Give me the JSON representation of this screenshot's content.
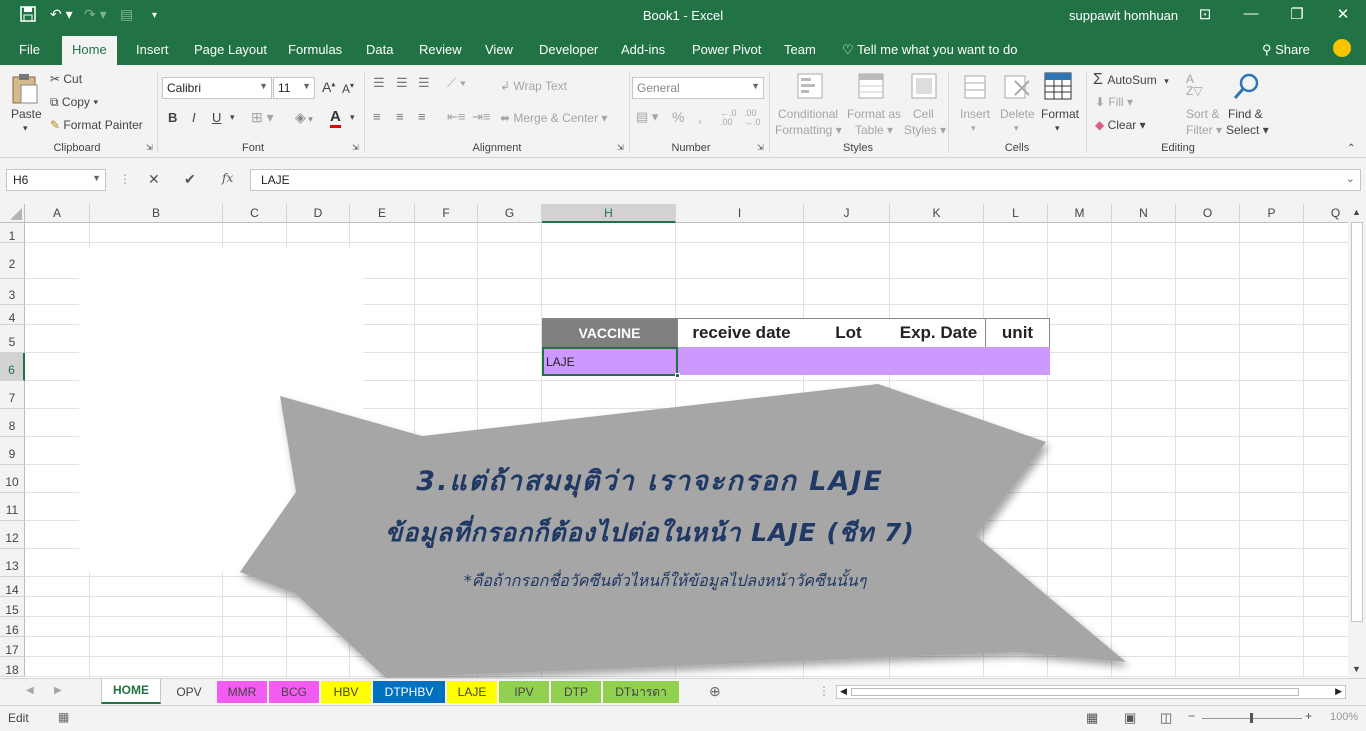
{
  "window": {
    "title": "Book1  -  Excel",
    "user": "suppawit homhuan"
  },
  "menu": {
    "tabs": [
      "File",
      "Home",
      "Insert",
      "Page Layout",
      "Formulas",
      "Data",
      "Review",
      "View",
      "Developer",
      "Add-ins",
      "Power Pivot",
      "Team"
    ],
    "tell_me": "Tell me what you want to do",
    "share": "Share"
  },
  "ribbon": {
    "clipboard": {
      "paste": "Paste",
      "cut": "Cut",
      "copy": "Copy",
      "format_painter": "Format Painter",
      "label": "Clipboard"
    },
    "font": {
      "name": "Calibri",
      "size": "11",
      "bold": "B",
      "italic": "I",
      "underline": "U",
      "label": "Font"
    },
    "alignment": {
      "wrap": "Wrap Text",
      "merge": "Merge & Center",
      "label": "Alignment"
    },
    "number": {
      "format": "General",
      "percent": "%",
      "label": "Number"
    },
    "styles": {
      "conditional_1": "Conditional",
      "conditional_2": "Formatting",
      "format_as_1": "Format as",
      "format_as_2": "Table",
      "cell_1": "Cell",
      "cell_2": "Styles",
      "label": "Styles"
    },
    "cells": {
      "insert": "Insert",
      "delete": "Delete",
      "format": "Format",
      "label": "Cells"
    },
    "editing": {
      "autosum": "AutoSum",
      "fill": "Fill",
      "clear": "Clear",
      "sort_1": "Sort &",
      "sort_2": "Filter",
      "find_1": "Find &",
      "find_2": "Select",
      "label": "Editing"
    }
  },
  "formula_bar": {
    "name_box": "H6",
    "fx": "fx",
    "content": "LAJE"
  },
  "columns": [
    "A",
    "B",
    "C",
    "D",
    "E",
    "F",
    "G",
    "H",
    "I",
    "J",
    "K",
    "L",
    "M",
    "N",
    "O",
    "P",
    "Q"
  ],
  "rows": [
    "1",
    "2",
    "3",
    "4",
    "5",
    "6",
    "7",
    "8",
    "9",
    "10",
    "11",
    "12",
    "13",
    "14",
    "15",
    "16",
    "17",
    "18"
  ],
  "table": {
    "headers": [
      "VACCINE",
      "receive date",
      "Lot",
      "Exp. Date",
      "unit"
    ],
    "row": [
      "LAJE",
      "",
      "",
      "",
      ""
    ]
  },
  "callout": {
    "line1": "3.แต่ถ้าสมมุติว่า เราจะกรอก LAJE",
    "line2": "ข้อมูลที่กรอกก็ต้องไปต่อในหน้า LAJE (ชีท 7)",
    "line3": "*คือถ้ากรอกชื่อวัคซีนตัวไหนก็ให้ข้อมูลไปลงหน้าวัคซีนนั้นๆ"
  },
  "sheets": [
    {
      "name": "HOME",
      "color": "#ffffff"
    },
    {
      "name": "OPV",
      "color": "#f3f3f3"
    },
    {
      "name": "MMR",
      "color": "#f25cf2"
    },
    {
      "name": "BCG",
      "color": "#f25cf2"
    },
    {
      "name": "HBV",
      "color": "#ffff00"
    },
    {
      "name": "DTPHBV",
      "color": "#0070c0"
    },
    {
      "name": "LAJE",
      "color": "#ffff00"
    },
    {
      "name": "IPV",
      "color": "#92d050"
    },
    {
      "name": "DTP",
      "color": "#92d050"
    },
    {
      "name": "DTมารดา",
      "color": "#92d050"
    }
  ],
  "status": {
    "mode": "Edit",
    "zoom": "100%"
  },
  "colors": {
    "excel_green": "#217346",
    "header_fill": "#7f7f7f",
    "data_fill": "#cc99ff",
    "callout": "#a6a6a6",
    "callout_text": "#1f3864"
  }
}
